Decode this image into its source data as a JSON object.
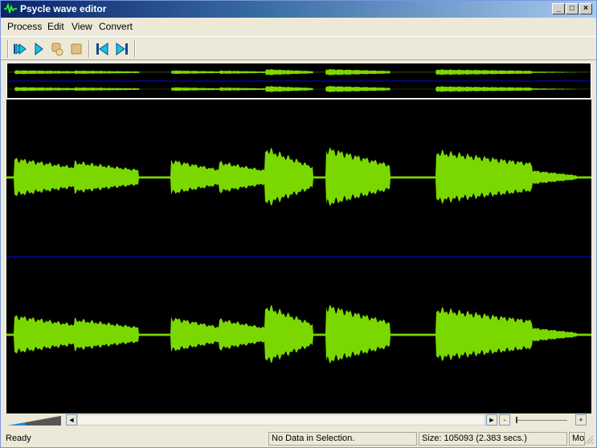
{
  "window": {
    "title": "Psycle wave editor",
    "controls": {
      "minimize": "_",
      "maximize": "□",
      "close": "×"
    }
  },
  "menu": {
    "items": [
      "Process",
      "Edit",
      "View",
      "Convert"
    ]
  },
  "toolbar": {
    "buttons": [
      {
        "name": "play-from-start",
        "icon": "play-from-start-icon"
      },
      {
        "name": "play",
        "icon": "play-icon"
      },
      {
        "name": "loop",
        "icon": "loop-icon"
      },
      {
        "name": "stop",
        "icon": "stop-icon"
      },
      {
        "name": "go-start",
        "icon": "skip-back-icon"
      },
      {
        "name": "go-end",
        "icon": "skip-forward-icon"
      }
    ]
  },
  "colors": {
    "wave": "#7ad800",
    "background": "#000000",
    "center_line": "#0000ff",
    "accent": "#1e88e5"
  },
  "scroll": {
    "left_arrow": "◄",
    "right_arrow": "►",
    "zoom_out": "-",
    "zoom_in": "+"
  },
  "status": {
    "ready": "Ready",
    "selection": "No Data in Selection.",
    "size": "Size: 105093 (2.383 secs.)",
    "mode": "Mo"
  }
}
